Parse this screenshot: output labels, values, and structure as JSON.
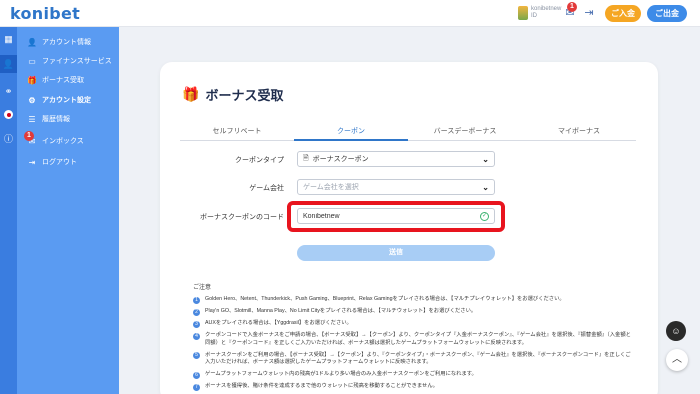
{
  "header": {
    "logo": "konibet",
    "user_name": "konibetnew",
    "user_sub": "ID",
    "notification_count": "1",
    "deposit_label": "ご入金",
    "withdraw_label": "ご出金",
    "deposit_color": "#f5a623",
    "withdraw_color": "#3d8be8"
  },
  "sidebar": {
    "items": [
      {
        "label": "アカウント情報",
        "icon": "user-icon"
      },
      {
        "label": "ファイナンスサービス",
        "icon": "finance-icon"
      },
      {
        "label": "ボーナス受取",
        "icon": "gift-icon"
      },
      {
        "label": "アカウント設定",
        "icon": "gear-icon"
      },
      {
        "label": "履歴情報",
        "icon": "history-icon"
      },
      {
        "label": "インボックス",
        "icon": "mail-icon",
        "badge": "1"
      },
      {
        "label": "ログアウト",
        "icon": "logout-icon"
      }
    ]
  },
  "page": {
    "title": "ボーナス受取",
    "tabs": [
      "セルフリベート",
      "クーポン",
      "バースデーボーナス",
      "マイボーナス"
    ],
    "active_tab": "クーポン"
  },
  "form": {
    "coupon_type_label": "クーポンタイプ",
    "coupon_type_value": "ボーナスクーポン",
    "game_company_label": "ゲーム会社",
    "game_company_placeholder": "ゲーム会社を選択",
    "coupon_code_label": "ボーナスクーポンのコード",
    "coupon_code_value": "Konibetnew",
    "submit_label": "送信"
  },
  "notes": {
    "heading": "ご注意",
    "items": [
      {
        "num": "1",
        "text": "Golden Hero、Netent、Thunderkick、Push Gaming、Blueprint、Relax Gamingをプレイされる場合は、【マルチプレイウォレット】をお選びください。"
      },
      {
        "num": "2",
        "text": "Play'n GO、Slotmill、Manna Play、No Limit Cityをプレイされる場合は、【マルチウォレット】をお選びください。"
      },
      {
        "num": "3",
        "text": "AUXをプレイされる場合は、【Yggdrasil】をお選びください。"
      },
      {
        "num": "4",
        "text": "クーポンコードで入金ボーナスをご申請の場合、【ボーナス受取】→【クーポン】より、クーポンタイプ『入金ボーナスクーポン』、『ゲーム会社』を選択後、『振替金額』（入金額と同額）と『クーポンコード』を正しくご入力いただければ、ボーナス額は選択したゲームプラットフォームウォレットに反映されます。"
      },
      {
        "num": "5",
        "text": "ボーナスクーポンをご利用の場合、【ボーナス受取】→【クーポン】より、『クーポンタイプ』・ボーナスクーポン、『ゲーム会社』を選択後、『ボーナスクーポンコード』を正しくご入力いただければ、ボーナス額は選択したゲームプラットフォームウォレットに反映されます。"
      },
      {
        "num": "6",
        "text": "ゲームプラットフォームウォレット内の残高が1ドルより多い場合のみ入金ボーナスクーポンをご利用になれます。"
      },
      {
        "num": "7",
        "text": "ボーナスを獲得後、賭け条件を達成するまで他のウォレットに残高を移動することができません。"
      }
    ]
  },
  "colors": {
    "accent": "#2f76c9",
    "sidebar": "#5a9bf2",
    "rail": "#3a7de0",
    "highlight": "#e8141e"
  }
}
